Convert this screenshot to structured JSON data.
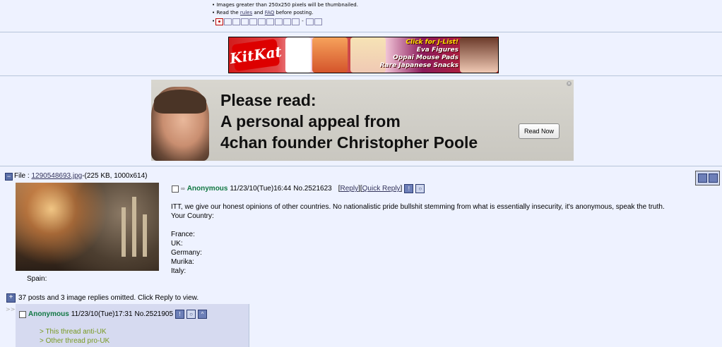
{
  "rules": {
    "line1": "Images greater than 250x250 pixels will be thumbnailed.",
    "line2_pre": "Read the ",
    "rules_link": "rules",
    "line2_mid": " and ",
    "faq_link": "FAQ",
    "line2_post": " before posting."
  },
  "banner1": {
    "brand": "KitKat",
    "line1": "Click for J-List!",
    "line2": "Eva Figures",
    "line3": "Oppai Mouse Pads",
    "line4": "Rare Japanese Snacks"
  },
  "banner2": {
    "line1": "Please read:",
    "line2": "A personal appeal from",
    "line3": "4chan founder Christopher Poole",
    "button": "Read Now"
  },
  "op": {
    "file_label": "File :",
    "file_name": "1290548693.jpg",
    "file_info": "-(225 KB, 1000x614)",
    "name": "Anonymous",
    "datetime": "11/23/10(Tue)16:44",
    "number": "No.2521623",
    "reply_link": "Reply",
    "quick_reply_link": "Quick Reply",
    "body": [
      "ITT, we give our honest opinions of other countries. No nationalistic pride bullshit stemming from what is essentially insecurity, it's anonymous, speak the truth.",
      "Your Country:",
      "",
      "France:",
      "UK:",
      "Germany:",
      "Murika:",
      "Italy:"
    ],
    "extra": "Spain:"
  },
  "omitted": "37 posts and 3 image replies omitted. Click Reply to view.",
  "reply": {
    "arrows": ">>",
    "name": "Anonymous",
    "datetime": "11/23/10(Tue)17:31",
    "number": "No.2521905",
    "quotes": [
      ">  This thread anti-UK",
      "> Other thread pro-UK"
    ]
  }
}
